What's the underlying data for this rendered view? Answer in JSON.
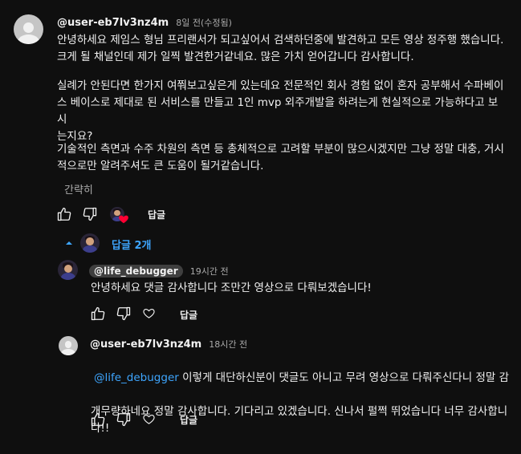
{
  "main_comment": {
    "author": "@user-eb7lv3nz4m",
    "time": "8일 전(수정됨)",
    "paragraph1": "안녕하세요 제임스 형님 프리랜서가 되고싶어서 검색하던중에 발견하고 모든 영상 정주행 했습니다.\n크게 될 채널인데 제가 일찍 발견한거같네요. 많은 가치 얻어갑니다 감사합니다.",
    "paragraph2": "실례가 안된다면 한가지 여쭤보고싶은게 있는데요 전문적인 회사 경험 없이 혼자 공부해서 수파베이\n스 베이스로 제대로 된 서비스를 만들고 1인 mvp 외주개발을 하려는게 현실적으로 가능하다고 보시\n는지요?",
    "paragraph3": "기술적인 측면과 수주 차원의 측면 등 총체적으로 고려할 부분이 많으시겠지만 그냥 정말 대충, 거시\n적으로만 알려주셔도 큰 도움이 될거같습니다.",
    "collapse_label": "간략히",
    "reply_label": "답글"
  },
  "replies_toggle": {
    "label": "답글 2개"
  },
  "replies": [
    {
      "author": "@life_debugger",
      "time": "19시간 전",
      "text": "안녕하세요 댓글 감사합니다 조만간 영상으로 다뤄보겠습니다!",
      "reply_label": "답글"
    },
    {
      "author": "@user-eb7lv3nz4m",
      "time": "18시간 전",
      "mention": "@life_debugger",
      "text_line1": " 이렇게 대단하신분이 댓글도 아니고 무려 영상으로 다뤄주신다니 정말 감",
      "text_rest": "개무량하네요 정말 감사합니다. 기다리고 있겠습니다. 신나서 펄쩍 뛰었습니다 너무 감사합니\n다!!",
      "reply_label": "답글"
    }
  ],
  "colors": {
    "background": "#0f0f0f",
    "text": "#f1f1f1",
    "meta": "#aaaaaa",
    "link": "#3ea6ff",
    "heart": "#ff0033"
  },
  "icons": [
    "thumb-up-icon",
    "thumb-down-icon",
    "heart-icon",
    "creator-heart-icon",
    "chevron-up-icon",
    "avatar-icon"
  ]
}
